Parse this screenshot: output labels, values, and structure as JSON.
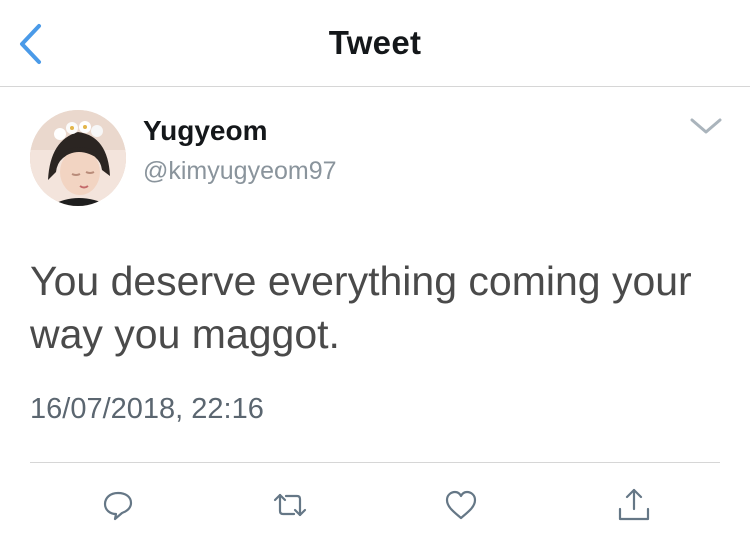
{
  "navbar": {
    "title": "Tweet"
  },
  "tweet": {
    "author_name": "Yugyeom",
    "author_handle": "@kimyugyeom97",
    "text": "You deserve everything coming your way you maggot.",
    "timestamp": "16/07/2018, 22:16"
  },
  "icons": {
    "back": "chevron-left-icon",
    "menu": "chevron-down-icon",
    "reply": "reply-icon",
    "retweet": "retweet-icon",
    "like": "heart-icon",
    "share": "share-icon"
  },
  "colors": {
    "accent": "#4a9ae8",
    "icon_gray": "#657786",
    "divider": "#d6d6d6"
  }
}
